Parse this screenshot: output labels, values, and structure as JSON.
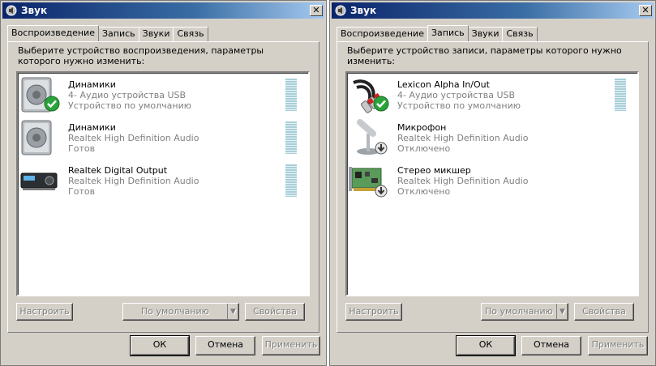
{
  "left_window": {
    "title": "Звук",
    "tabs": [
      "Воспроизведение",
      "Запись",
      "Звуки",
      "Связь"
    ],
    "active_tab": "Воспроизведение",
    "prompt": "Выберите устройство воспроизведения, параметры которого нужно изменить:",
    "devices": [
      {
        "name": "Динамики",
        "line1": "4- Аудио устройства USB",
        "line2": "Устройство по умолчанию",
        "icon": "speaker-icon",
        "status_icon": "green-check-icon"
      },
      {
        "name": "Динамики",
        "line1": "Realtek High Definition Audio",
        "line2": "Готов",
        "icon": "speaker-icon"
      },
      {
        "name": "Realtek Digital Output",
        "line1": "Realtek High Definition Audio",
        "line2": "Готов",
        "icon": "digital-receiver-icon"
      }
    ],
    "buttons": {
      "configure": "Настроить",
      "set_default": "По умолчанию",
      "properties": "Свойства"
    },
    "footer": {
      "ok": "ОК",
      "cancel": "Отмена",
      "apply": "Применить"
    }
  },
  "right_window": {
    "title": "Звук",
    "tabs": [
      "Воспроизведение",
      "Запись",
      "Звуки",
      "Связь"
    ],
    "active_tab": "Запись",
    "prompt": "Выберите устройство записи, параметры которого нужно изменить:",
    "devices": [
      {
        "name": "Lexicon Alpha In/Out",
        "line1": "4- Аудио устройства USB",
        "line2": "Устройство по умолчанию",
        "icon": "rca-cable-icon",
        "status_icon": "green-check-icon"
      },
      {
        "name": "Микрофон",
        "line1": "Realtek High Definition Audio",
        "line2": "Отключено",
        "icon": "microphone-icon",
        "status_icon": "disabled-arrow-icon"
      },
      {
        "name": "Стерео микшер",
        "line1": "Realtek High Definition Audio",
        "line2": "Отключено",
        "icon": "sound-card-icon",
        "status_icon": "disabled-arrow-icon"
      }
    ],
    "buttons": {
      "configure": "Настроить",
      "set_default": "По умолчанию",
      "properties": "Свойства"
    },
    "footer": {
      "ok": "ОК",
      "cancel": "Отмена",
      "apply": "Применить"
    }
  }
}
